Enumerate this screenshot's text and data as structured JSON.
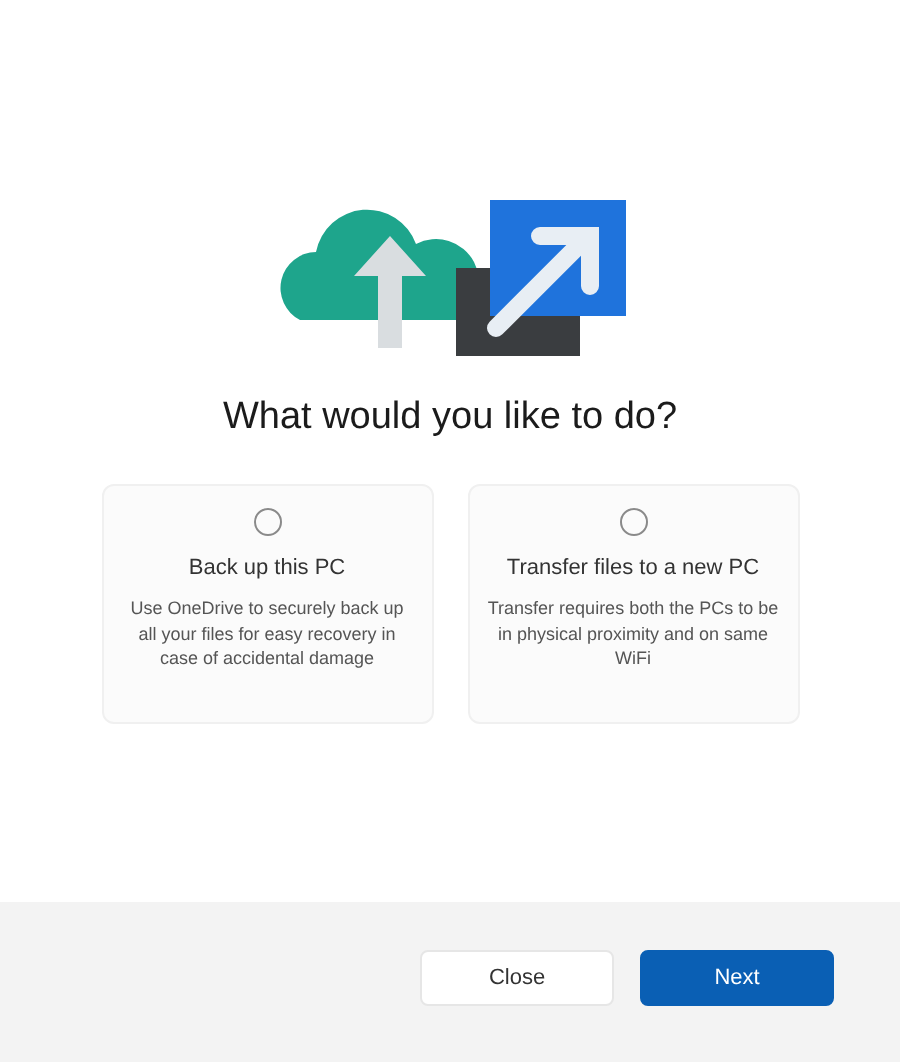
{
  "heading": "What would you like to do?",
  "options": [
    {
      "title": "Back up this PC",
      "description": "Use OneDrive to securely back up all your files for easy recovery in case of accidental damage",
      "selected": false
    },
    {
      "title": "Transfer files to a new PC",
      "description": "Transfer requires both the PCs to be in physical proximity and on same WiFi",
      "selected": false
    }
  ],
  "buttons": [
    {
      "label": "Close",
      "kind": "secondary"
    },
    {
      "label": "Next",
      "kind": "primary"
    }
  ]
}
